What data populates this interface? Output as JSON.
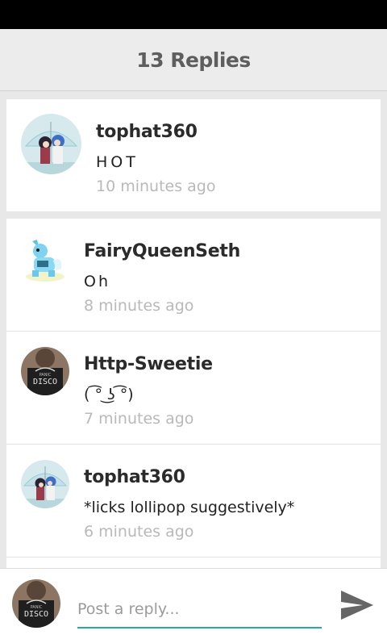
{
  "header": {
    "title": "13 Replies"
  },
  "original_post": {
    "username": "tophat360",
    "message": "HOT",
    "time": "10 minutes ago"
  },
  "replies": [
    {
      "username": "FairyQueenSeth",
      "message": "Oh",
      "time": "8 minutes ago"
    },
    {
      "username": "Http-Sweetie",
      "message": "( ͡° ͜ʖ ͡°)",
      "time": "7 minutes ago"
    },
    {
      "username": "tophat360",
      "message": "*licks lollipop suggestively*",
      "time": "6 minutes ago"
    }
  ],
  "reply_bar": {
    "placeholder": "Post a reply..."
  },
  "colors": {
    "accent": "#2aa8a8",
    "send_icon": "#666666",
    "timestamp": "#b9b9b9"
  },
  "icons": {
    "send": "send-icon"
  }
}
